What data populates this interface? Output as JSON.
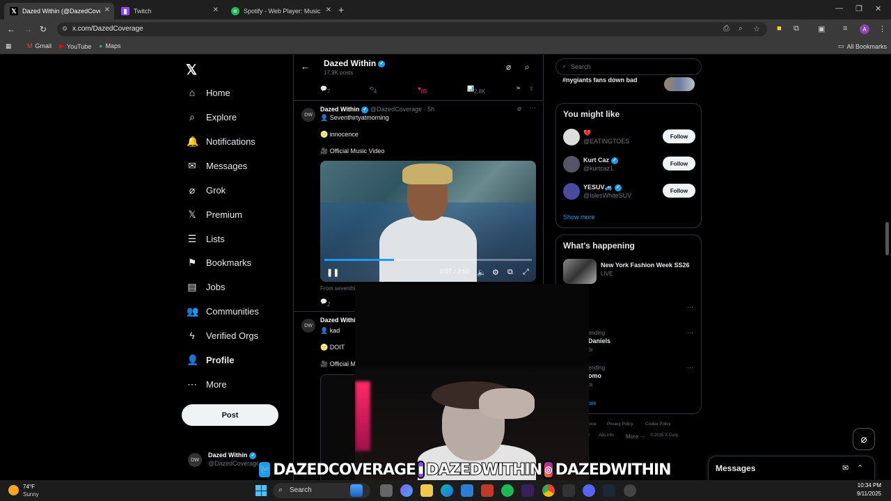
{
  "browser": {
    "tabs": [
      {
        "label": "Dazed Within (@DazedCoverag",
        "icon": "x-logo-icon",
        "active": true
      },
      {
        "label": "Twitch",
        "icon": "twitch-icon",
        "active": false
      },
      {
        "label": "Spotify - Web Player: Music for",
        "icon": "spotify-icon",
        "active": false
      }
    ],
    "url": "x.com/DazedCoverage",
    "bookmarks": [
      "Gmail",
      "YouTube",
      "Maps"
    ],
    "all_bookmarks": "All Bookmarks",
    "profile_initial": "A"
  },
  "sidebar": {
    "items": [
      {
        "label": "Home",
        "icon": "home-icon"
      },
      {
        "label": "Explore",
        "icon": "search-icon"
      },
      {
        "label": "Notifications",
        "icon": "bell-icon"
      },
      {
        "label": "Messages",
        "icon": "mail-icon"
      },
      {
        "label": "Grok",
        "icon": "grok-icon"
      },
      {
        "label": "Premium",
        "icon": "x-logo-icon"
      },
      {
        "label": "Lists",
        "icon": "list-icon"
      },
      {
        "label": "Bookmarks",
        "icon": "bookmark-icon"
      },
      {
        "label": "Jobs",
        "icon": "briefcase-icon"
      },
      {
        "label": "Communities",
        "icon": "people-icon"
      },
      {
        "label": "Verified Orgs",
        "icon": "lightning-icon"
      },
      {
        "label": "Profile",
        "icon": "person-icon"
      },
      {
        "label": "More",
        "icon": "more-circle-icon"
      }
    ],
    "post_button": "Post",
    "account": {
      "name": "Dazed Within",
      "handle": "@DazedCoverage"
    }
  },
  "header": {
    "title": "Dazed Within",
    "posts": "17.9K posts"
  },
  "prev_actions": {
    "replies": "7",
    "reposts": "4",
    "likes": "85",
    "views": "2.8K"
  },
  "tweet1": {
    "name": "Dazed Within",
    "handle": "@DazedCoverage",
    "time": "5h",
    "line1": "👤 Seventhirtyatmorning",
    "line2": "🌝 innocence",
    "line3": "🎥 Official Music Video",
    "video_time": "0:57 / 2:50",
    "video_progress": 0.335,
    "from": "From seventhi",
    "replies": "2"
  },
  "tweet2": {
    "name": "Dazed Within",
    "line1": "👤 kad",
    "line2": "🌝 DOIT",
    "line3": "🎥 Official M"
  },
  "right": {
    "search_placeholder": "Search",
    "trend_top": "#nygiants fans down bad",
    "might_like_title": "You might like",
    "suggestions": [
      {
        "name": "💔",
        "handle": "@EATINGTOES",
        "follow": "Follow"
      },
      {
        "name": "Kurt Caz",
        "handle": "@kurtcaz1",
        "follow": "Follow"
      },
      {
        "name": "YESUV🚙",
        "handle": "@IslesWhiteSUV",
        "follow": "Follow"
      }
    ],
    "show_more": "Show more",
    "happening_title": "What's happening",
    "happening_item": {
      "title": "New York Fashion Week SS26",
      "status": "LIVE"
    },
    "trend_a_status": "ending",
    "trend_a_name": "Daniels",
    "trend_a_count": "ts",
    "trend_b_status": "ending",
    "trend_b_name": "omo",
    "trend_b_count": "ts",
    "trend_more": "ore",
    "footer": {
      "l1a": "rvice",
      "l1b": "Privacy Policy",
      "l1c": "Cookie Policy",
      "l2a": "y",
      "l2b": "Ads info",
      "l2c": "More ···",
      "l2d": "© 2025 X Corp."
    }
  },
  "messages_dock": {
    "title": "Messages"
  },
  "banner": {
    "twitter": "DAZEDCOVERAGE",
    "twitch": "DAZEDWITHIN",
    "instagram": "DAZEDWITHIN"
  },
  "taskbar": {
    "temp": "74°F",
    "condition": "Sunny",
    "search": "Search",
    "time": "10:34 PM",
    "date": "9/11/2025"
  }
}
